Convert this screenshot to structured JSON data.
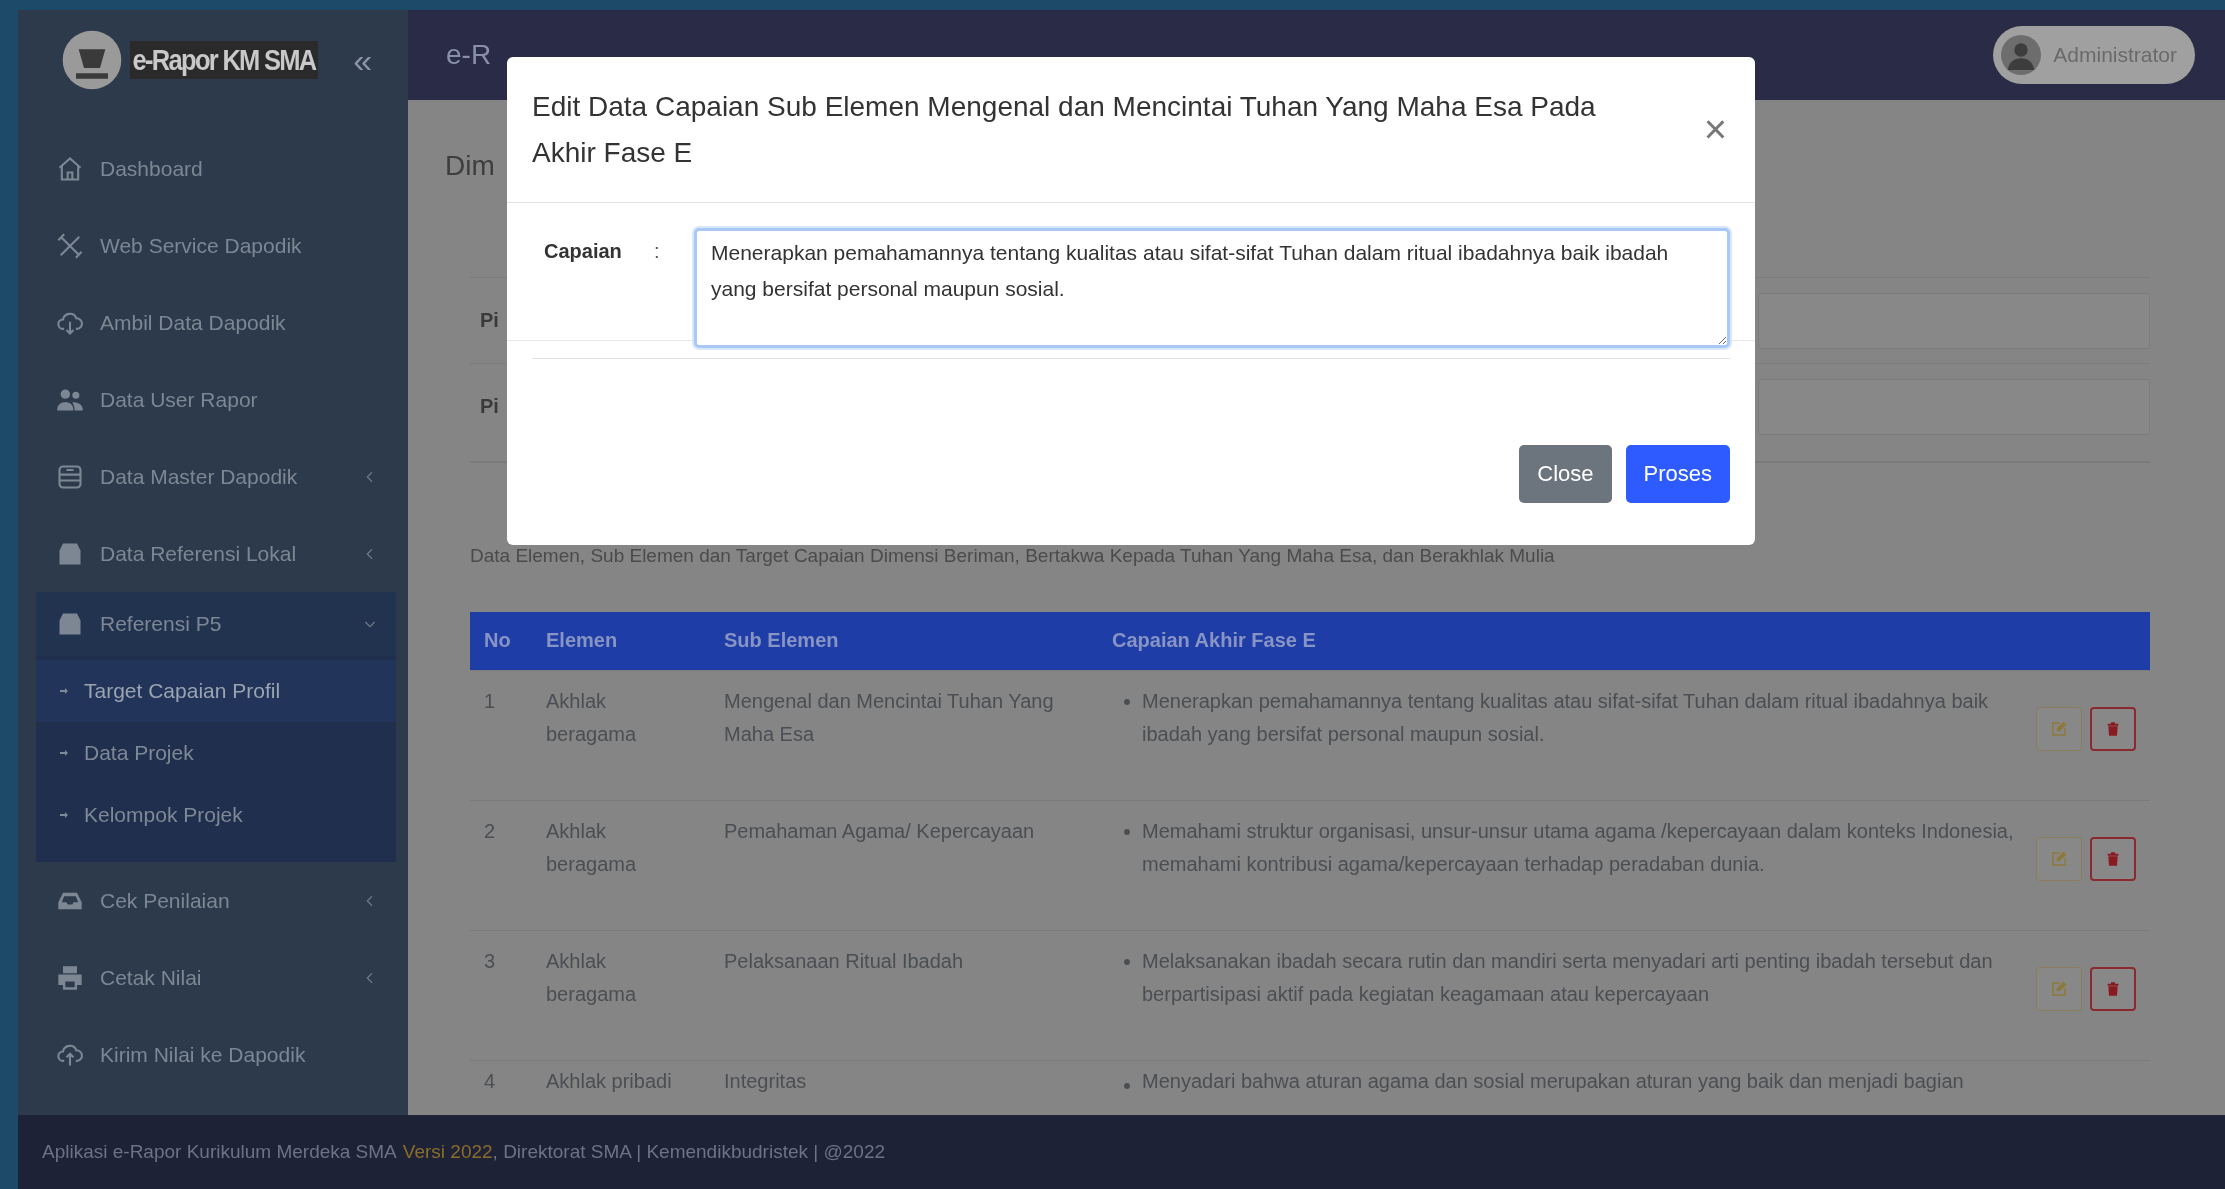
{
  "sidebar": {
    "logo_text": "e-Rapor KM SMA",
    "collapse": "«",
    "items": [
      {
        "kind": "link",
        "label": "Dashboard"
      },
      {
        "kind": "link",
        "label": "Web Service Dapodik"
      },
      {
        "kind": "link",
        "label": "Ambil Data Dapodik"
      },
      {
        "kind": "link",
        "label": "Data User Rapor"
      },
      {
        "kind": "menu",
        "label": "Data Master Dapodik",
        "expanded": false
      },
      {
        "kind": "menu",
        "label": "Data Referensi Lokal",
        "expanded": false
      },
      {
        "kind": "menu",
        "label": "Referensi P5",
        "expanded": true,
        "children": [
          {
            "label": "Target Capaian Profil",
            "selected": true
          },
          {
            "label": "Data Projek",
            "selected": false
          },
          {
            "label": "Kelompok Projek",
            "selected": false
          }
        ]
      },
      {
        "kind": "menu",
        "label": "Cek Penilaian",
        "expanded": false
      },
      {
        "kind": "menu",
        "label": "Cetak Nilai",
        "expanded": false
      },
      {
        "kind": "link",
        "label": "Kirim Nilai ke Dapodik"
      }
    ]
  },
  "header": {
    "title": "e-R",
    "user": "Administrator"
  },
  "page": {
    "title": "Dim",
    "form_labels": [
      "Pi",
      "Pi"
    ],
    "description": "Data Elemen, Sub Elemen dan Target Capaian Dimensi Beriman, Bertakwa Kepada Tuhan Yang Maha Esa, dan Berakhlak Mulia"
  },
  "table": {
    "columns": [
      "No",
      "Elemen",
      "Sub Elemen",
      "Capaian Akhir Fase E"
    ],
    "rows": [
      {
        "no": "1",
        "elemen": "Akhlak beragama",
        "sub_elemen": "Mengenal dan Mencintai Tuhan Yang Maha Esa",
        "capaian": "Menerapkan pemahamannya tentang kualitas atau sifat-sifat Tuhan dalam ritual ibadahnya baik ibadah yang bersifat personal maupun sosial.",
        "actions": true
      },
      {
        "no": "2",
        "elemen": "Akhlak beragama",
        "sub_elemen": "Pemahaman Agama/ Kepercayaan",
        "capaian": "Memahami struktur organisasi, unsur-unsur utama agama /kepercayaan dalam konteks Indonesia, memahami kontribusi agama/kepercayaan terhadap peradaban dunia.",
        "actions": true
      },
      {
        "no": "3",
        "elemen": "Akhlak beragama",
        "sub_elemen": "Pelaksanaan Ritual Ibadah",
        "capaian": "Melaksanakan ibadah secara rutin dan mandiri serta menyadari arti penting ibadah tersebut dan berpartisipasi aktif pada kegiatan keagamaan atau kepercayaan",
        "actions": true
      },
      {
        "no": "4",
        "elemen": "Akhlak pribadi",
        "sub_elemen": "Integritas",
        "capaian": "Menyadari bahwa aturan agama dan sosial merupakan aturan yang baik dan menjadi bagian",
        "actions": false
      }
    ]
  },
  "modal": {
    "title": "Edit Data Capaian Sub Elemen Mengenal dan Mencintai Tuhan Yang Maha Esa Pada Akhir Fase E",
    "close": "×",
    "field_label": "Capaian",
    "separator": ":",
    "value": "Menerapkan pemahamannya tentang kualitas atau sifat-sifat Tuhan dalam ritual ibadahnya baik ibadah yang bersifat personal maupun sosial.",
    "buttons": [
      {
        "kind": "secondary",
        "label": "Close"
      },
      {
        "kind": "primary",
        "label": "Proses"
      }
    ]
  },
  "footer": {
    "before": "Aplikasi e-Rapor Kurikulum Merdeka SMA",
    "version": "Versi 2022",
    "after": ", Direktorat SMA | Kemendikbudristek | @2022"
  }
}
